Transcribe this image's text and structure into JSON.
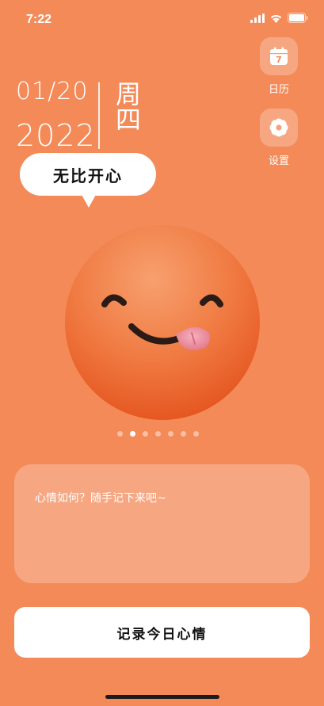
{
  "status_bar": {
    "time": "7:22"
  },
  "date": {
    "month_day": "01/20",
    "year": "2022",
    "weekday": "周四"
  },
  "side_buttons": {
    "calendar": {
      "label": "日历",
      "icon": "calendar-icon",
      "day": "7"
    },
    "settings": {
      "label": "设置",
      "icon": "flower-gear-icon"
    }
  },
  "mood": {
    "label": "无比开心",
    "icon": "tongue-out-emoji"
  },
  "carousel": {
    "count": 7,
    "active_index": 1
  },
  "note": {
    "placeholder": "心情如何？随手记下来吧~"
  },
  "record_button": {
    "label": "记录今日心情"
  },
  "colors": {
    "background": "#f38a58",
    "card": "#ffffff",
    "text_dark": "#111111"
  }
}
